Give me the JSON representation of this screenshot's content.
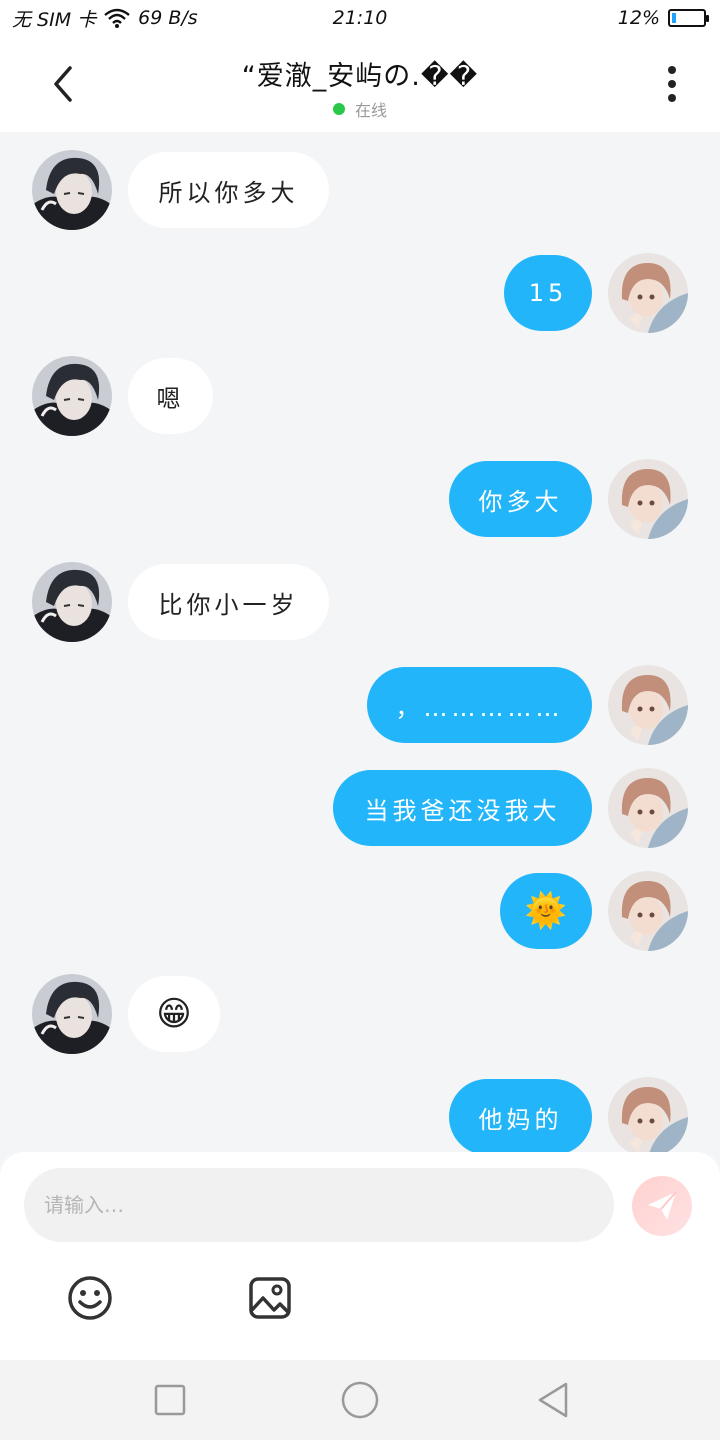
{
  "status_bar": {
    "carrier": "无 SIM 卡",
    "speed": "69 B/s",
    "time": "21:10",
    "battery": "12%",
    "battery_level": 0.12
  },
  "header": {
    "title": "“爱澈_安屿の.��",
    "status": "在线"
  },
  "colors": {
    "outgoing_bubble": "#22b5f9",
    "incoming_bubble": "#ffffff",
    "online": "#2ac84a",
    "background": "#f4f5f7"
  },
  "messages": [
    {
      "side": "in",
      "text": "所以你多大"
    },
    {
      "side": "out",
      "text": "15"
    },
    {
      "side": "in",
      "text": "嗯"
    },
    {
      "side": "out",
      "text": "你多大"
    },
    {
      "side": "in",
      "text": "比你小一岁"
    },
    {
      "side": "out",
      "text": "，……………"
    },
    {
      "side": "out",
      "text": "当我爸还没我大"
    },
    {
      "side": "out",
      "text": "🌞"
    },
    {
      "side": "in",
      "text": "😁"
    },
    {
      "side": "out",
      "text": "他妈的"
    }
  ],
  "input": {
    "placeholder": "请输入…",
    "value": ""
  },
  "icons": {
    "back": "chevron-left-icon",
    "more": "more-vertical-icon",
    "send": "paper-plane-icon",
    "emoji": "smiley-icon",
    "image": "image-icon",
    "nav_recent": "square-icon",
    "nav_home": "circle-icon",
    "nav_back": "triangle-back-icon"
  }
}
